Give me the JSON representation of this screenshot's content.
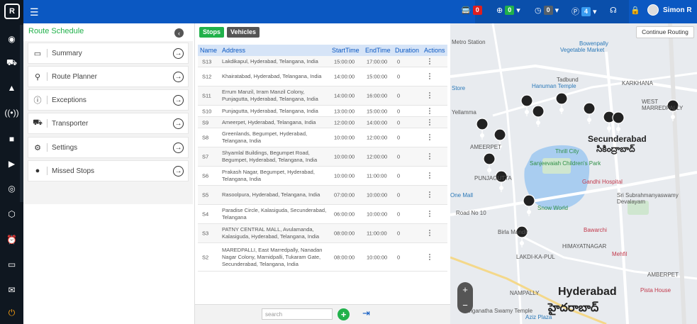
{
  "header": {
    "menu_icon": "hamburger-icon",
    "alerts_count": "0",
    "online_count": "0",
    "time_count": "0",
    "parking_count": "4",
    "user_name": "Simon R"
  },
  "left_panel": {
    "title": "Route Schedule",
    "items": [
      {
        "label": "Summary",
        "icon": "summary-icon"
      },
      {
        "label": "Route Planner",
        "icon": "route-planner-icon"
      },
      {
        "label": "Exceptions",
        "icon": "exceptions-icon"
      },
      {
        "label": "Transporter",
        "icon": "transporter-icon"
      },
      {
        "label": "Settings",
        "icon": "settings-icon"
      },
      {
        "label": "Missed Stops",
        "icon": "missed-stops-icon"
      }
    ]
  },
  "tabs": {
    "stops": "Stops",
    "vehicles": "Vehicles"
  },
  "table": {
    "columns": [
      "Name",
      "Address",
      "StartTime",
      "EndTime",
      "Duration",
      "Actions"
    ],
    "rows": [
      {
        "name": "S13",
        "address": "Lakdikapul, Hyderabad, Telangana, India",
        "start": "15:00:00",
        "end": "17:00:00",
        "duration": "0"
      },
      {
        "name": "S12",
        "address": "Khairatabad, Hyderabad, Telangana, India",
        "start": "14:00:00",
        "end": "15:00:00",
        "duration": "0"
      },
      {
        "name": "S11",
        "address": "Errum Manzil, Irram Manzil Colony, Punjagutta, Hyderabad, Telangana, India",
        "start": "14:00:00",
        "end": "16:00:00",
        "duration": "0"
      },
      {
        "name": "S10",
        "address": "Punjagutta, Hyderabad, Telangana, India",
        "start": "13:00:00",
        "end": "15:00:00",
        "duration": "0"
      },
      {
        "name": "S9",
        "address": "Ameerpet, Hyderabad, Telangana, India",
        "start": "12:00:00",
        "end": "14:00:00",
        "duration": "0"
      },
      {
        "name": "S8",
        "address": "Greenlands, Begumpet, Hyderabad, Telangana, India",
        "start": "10:00:00",
        "end": "12:00:00",
        "duration": "0"
      },
      {
        "name": "S7",
        "address": "Shyamlal Buildings, Begumpet Road, Begumpet, Hyderabad, Telangana, India",
        "start": "10:00:00",
        "end": "12:00:00",
        "duration": "0"
      },
      {
        "name": "S6",
        "address": "Prakash Nagar, Begumpet, Hyderabad, Telangana, India",
        "start": "10:00:00",
        "end": "11:00:00",
        "duration": "0"
      },
      {
        "name": "S5",
        "address": "Rasoolpura, Hyderabad, Telangana, India",
        "start": "07:00:00",
        "end": "10:00:00",
        "duration": "0"
      },
      {
        "name": "S4",
        "address": "Paradise Circle, Kalasiguda, Secunderabad, Telangana",
        "start": "06:00:00",
        "end": "10:00:00",
        "duration": "0"
      },
      {
        "name": "S3",
        "address": "PATNY CENTRAL MALL, Avulamanda, Kalasiguda, Hyderabad, Telangana, India",
        "start": "08:00:00",
        "end": "11:00:00",
        "duration": "0"
      },
      {
        "name": "S2",
        "address": "MAREDPALLI, East Marredpally, Nanadan Nagar Colony, Mamidpalli, Tukaram Gate, Secunderabad, Telangana, India",
        "start": "08:00:00",
        "end": "10:00:00",
        "duration": "0"
      }
    ],
    "search_placeholder": "search"
  },
  "map": {
    "continue_routing": "Continue Routing",
    "labels": {
      "bowenpally": "Bowenpally",
      "vegetable_market": "Vegetable Market",
      "hanuman_temple": "Hanuman Temple",
      "tadbund": "Tadbund",
      "secunderabad": "Secunderabad",
      "secunderabad_te": "సికింద్రాబాద్",
      "thrill_city": "Thrill City",
      "sanjeevaiah": "Sanjeevaiah Children's Park",
      "gandhi_hospital": "Gandhi Hospital",
      "sri_subrahmanyaswamy": "Sri Subrahmanyaswamy Devalayam",
      "snow_world": "Snow World",
      "birla_mandir": "Birla Mandir",
      "bawarchi": "Bawarchi",
      "mehfil": "Mehfil",
      "hyderabad": "Hyderabad",
      "hyderabad_te": "హైదరాబాద్",
      "pista_house": "Pista House",
      "yellamma": "Yellamma",
      "one_mall": "One Mall",
      "store": "Store",
      "aziz_plaza": "Aziz Plaza",
      "nampally": "NAMPALLY",
      "amberpet": "AMBERPET",
      "karkhana": "KARKHANA",
      "west_marredpally": "WEST MARREDPALLY",
      "himayatnagar": "HIMAYATNAGAR",
      "lakdikapul": "LAKDI-KA-PUL",
      "punjagutta": "PUNJAGUTTA",
      "ameerpet": "AMEERPET",
      "metro_station": "Metro Station",
      "road_no_10": "Road No 10",
      "anganatha_swamy": "anganatha Swamy Temple"
    }
  }
}
